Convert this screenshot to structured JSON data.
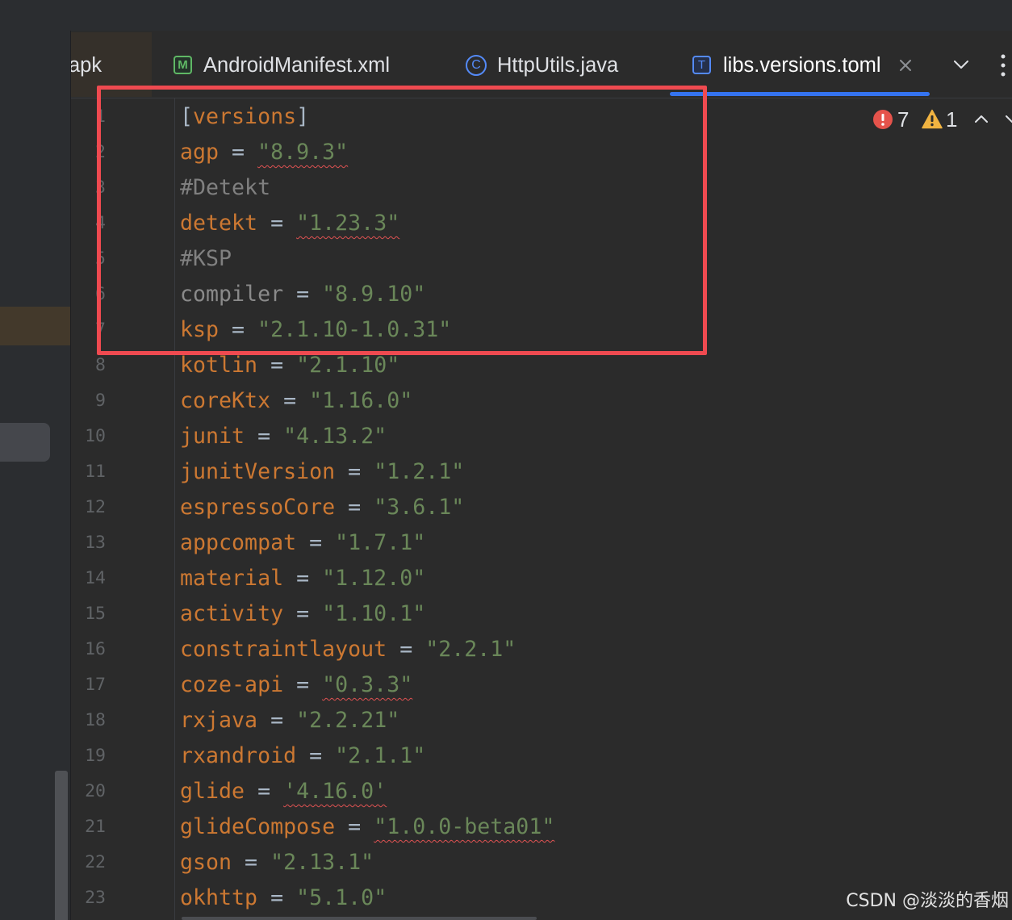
{
  "tabs": [
    {
      "label": "apk"
    },
    {
      "label": "AndroidManifest.xml",
      "icon": "manifest-file-icon",
      "icon_letter": "M"
    },
    {
      "label": "HttpUtils.java",
      "icon": "java-class-icon",
      "icon_letter": "C"
    },
    {
      "label": "libs.versions.toml",
      "icon": "toml-file-icon",
      "icon_letter": "T",
      "active": true
    }
  ],
  "icons": {
    "close": "close-icon",
    "tab_overflow": "chevron-down-icon",
    "more": "more-vertical-icon",
    "error": "error-icon",
    "warning": "warning-icon",
    "previous": "chevron-up-icon",
    "next": "chevron-down-icon"
  },
  "inspections": {
    "errors": "7",
    "warnings": "1"
  },
  "editor": {
    "lines": [
      {
        "number": "1",
        "tokens": [
          {
            "text": "[",
            "kind": "bracket"
          },
          {
            "text": "versions",
            "kind": "table"
          },
          {
            "text": "]",
            "kind": "bracket"
          }
        ]
      },
      {
        "number": "2",
        "tokens": [
          {
            "text": "agp",
            "kind": "key"
          },
          {
            "text": " = ",
            "kind": "eq"
          },
          {
            "text": "\"8.9.3\"",
            "kind": "string",
            "error": true
          }
        ]
      },
      {
        "number": "3",
        "tokens": [
          {
            "text": "#Detekt",
            "kind": "comment"
          }
        ]
      },
      {
        "number": "4",
        "tokens": [
          {
            "text": "detekt",
            "kind": "key"
          },
          {
            "text": " = ",
            "kind": "eq"
          },
          {
            "text": "\"1.23.3\"",
            "kind": "string",
            "error": true
          }
        ]
      },
      {
        "number": "5",
        "tokens": [
          {
            "text": "#KSP",
            "kind": "comment"
          }
        ]
      },
      {
        "number": "6",
        "tokens": [
          {
            "text": "compiler",
            "kind": "key-unused"
          },
          {
            "text": " = ",
            "kind": "eq"
          },
          {
            "text": "\"8.9.10\"",
            "kind": "string"
          }
        ]
      },
      {
        "number": "7",
        "tokens": [
          {
            "text": "ksp",
            "kind": "key"
          },
          {
            "text": " = ",
            "kind": "eq"
          },
          {
            "text": "\"2.1.10-1.0.31\"",
            "kind": "string"
          }
        ]
      },
      {
        "number": "8",
        "tokens": [
          {
            "text": "kotlin",
            "kind": "key"
          },
          {
            "text": " = ",
            "kind": "eq"
          },
          {
            "text": "\"2.1.10\"",
            "kind": "string"
          }
        ]
      },
      {
        "number": "9",
        "tokens": [
          {
            "text": "coreKtx",
            "kind": "key"
          },
          {
            "text": " = ",
            "kind": "eq"
          },
          {
            "text": "\"1.16.0\"",
            "kind": "string"
          }
        ]
      },
      {
        "number": "10",
        "tokens": [
          {
            "text": "junit",
            "kind": "key"
          },
          {
            "text": " = ",
            "kind": "eq"
          },
          {
            "text": "\"4.13.2\"",
            "kind": "string"
          }
        ]
      },
      {
        "number": "11",
        "tokens": [
          {
            "text": "junitVersion",
            "kind": "key"
          },
          {
            "text": " = ",
            "kind": "eq"
          },
          {
            "text": "\"1.2.1\"",
            "kind": "string"
          }
        ]
      },
      {
        "number": "12",
        "tokens": [
          {
            "text": "espressoCore",
            "kind": "key"
          },
          {
            "text": " = ",
            "kind": "eq"
          },
          {
            "text": "\"3.6.1\"",
            "kind": "string"
          }
        ]
      },
      {
        "number": "13",
        "tokens": [
          {
            "text": "appcompat",
            "kind": "key"
          },
          {
            "text": " = ",
            "kind": "eq"
          },
          {
            "text": "\"1.7.1\"",
            "kind": "string"
          }
        ]
      },
      {
        "number": "14",
        "tokens": [
          {
            "text": "material",
            "kind": "key"
          },
          {
            "text": " = ",
            "kind": "eq"
          },
          {
            "text": "\"1.12.0\"",
            "kind": "string"
          }
        ]
      },
      {
        "number": "15",
        "tokens": [
          {
            "text": "activity",
            "kind": "key"
          },
          {
            "text": " = ",
            "kind": "eq"
          },
          {
            "text": "\"1.10.1\"",
            "kind": "string"
          }
        ]
      },
      {
        "number": "16",
        "tokens": [
          {
            "text": "constraintlayout",
            "kind": "key"
          },
          {
            "text": " = ",
            "kind": "eq"
          },
          {
            "text": "\"2.2.1\"",
            "kind": "string"
          }
        ]
      },
      {
        "number": "17",
        "tokens": [
          {
            "text": "coze-api",
            "kind": "key"
          },
          {
            "text": " = ",
            "kind": "eq"
          },
          {
            "text": "\"0.3.3\"",
            "kind": "string",
            "error": true
          }
        ]
      },
      {
        "number": "18",
        "tokens": [
          {
            "text": "rxjava",
            "kind": "key"
          },
          {
            "text": " = ",
            "kind": "eq"
          },
          {
            "text": "\"2.2.21\"",
            "kind": "string"
          }
        ]
      },
      {
        "number": "19",
        "tokens": [
          {
            "text": "rxandroid",
            "kind": "key"
          },
          {
            "text": " = ",
            "kind": "eq"
          },
          {
            "text": "\"2.1.1\"",
            "kind": "string"
          }
        ]
      },
      {
        "number": "20",
        "tokens": [
          {
            "text": "glide",
            "kind": "key"
          },
          {
            "text": " = ",
            "kind": "eq"
          },
          {
            "text": "'4.16.0'",
            "kind": "string",
            "error": true
          }
        ]
      },
      {
        "number": "21",
        "tokens": [
          {
            "text": "glideCompose",
            "kind": "key"
          },
          {
            "text": " = ",
            "kind": "eq"
          },
          {
            "text": "\"1.0.0-beta01\"",
            "kind": "string",
            "error": true
          }
        ]
      },
      {
        "number": "22",
        "tokens": [
          {
            "text": "gson",
            "kind": "key"
          },
          {
            "text": " = ",
            "kind": "eq"
          },
          {
            "text": "\"2.13.1\"",
            "kind": "string"
          }
        ]
      },
      {
        "number": "23",
        "tokens": [
          {
            "text": "okhttp",
            "kind": "key"
          },
          {
            "text": " = ",
            "kind": "eq"
          },
          {
            "text": "\"5.1.0\"",
            "kind": "string"
          }
        ]
      }
    ]
  },
  "watermark": "CSDN @淡淡的香烟",
  "colors": {
    "editor_bg": "#2b2b2b",
    "panel_bg": "#2b2d30",
    "accent": "#3574f0",
    "key": "#cc7832",
    "key_unused": "#8a8a8a",
    "string": "#6a8759",
    "comment": "#808080",
    "operator": "#a9b7c6",
    "line_number": "#606366",
    "error": "#e5534b",
    "warning": "#f0b341",
    "error_underline": "#e05252",
    "annotation": "#ef4a50",
    "manifest_icon": "#5fb865",
    "class_icon": "#548af7"
  }
}
